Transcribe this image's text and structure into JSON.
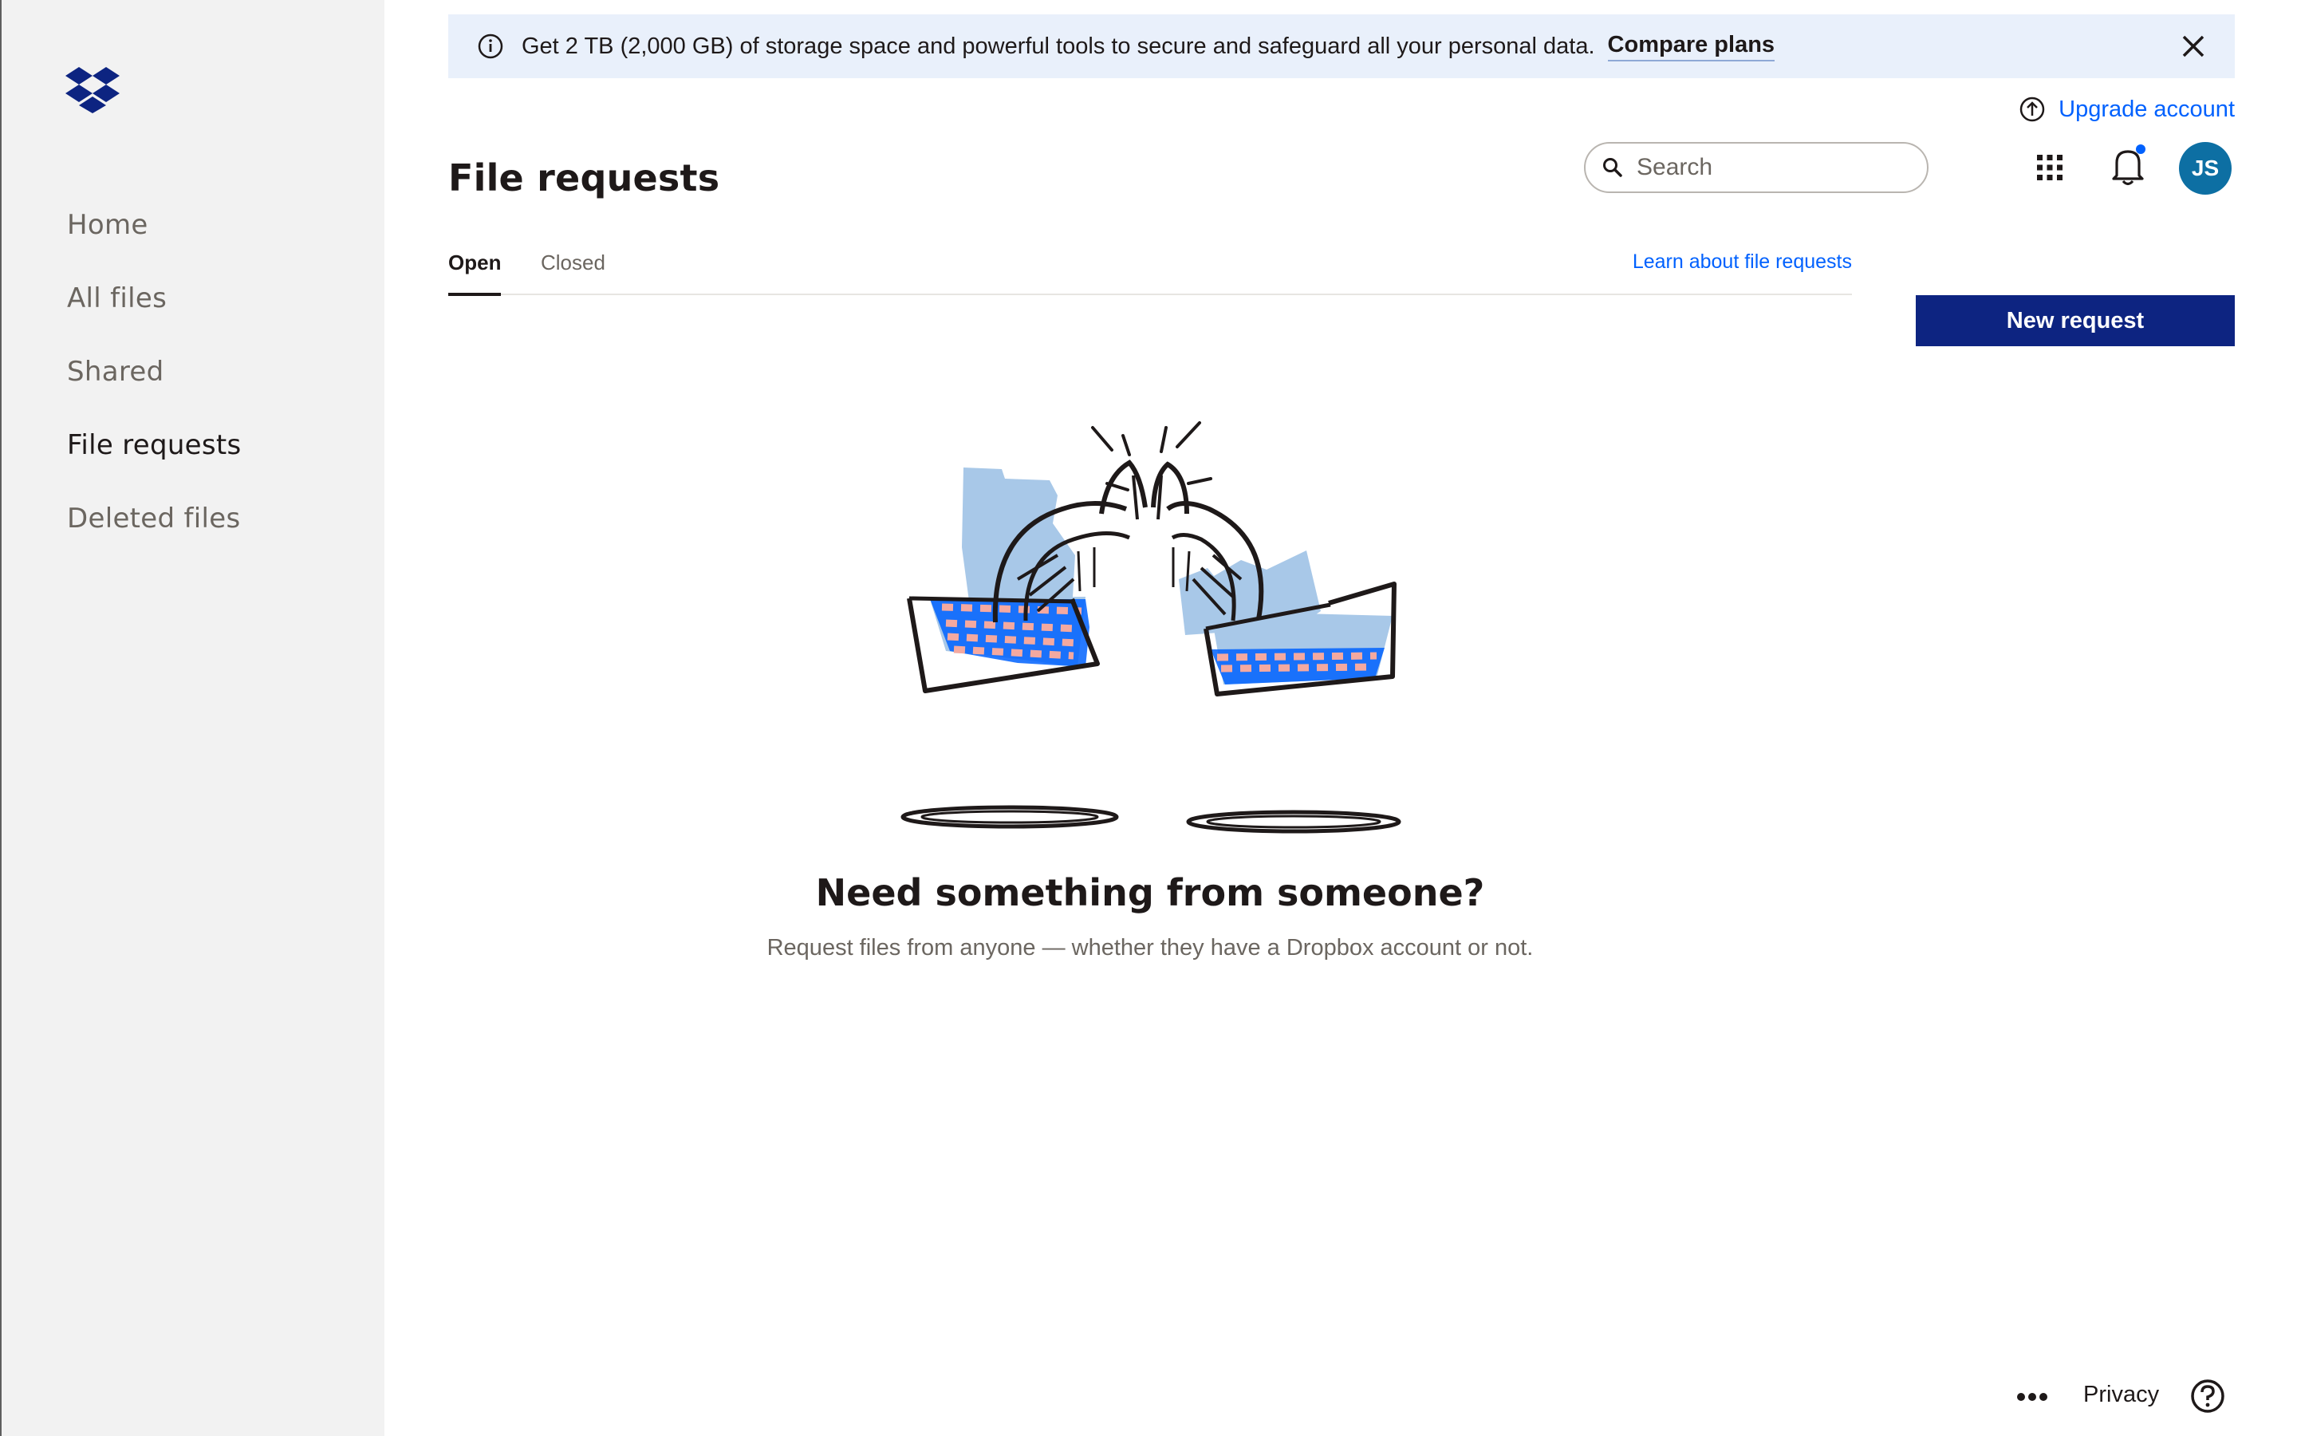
{
  "sidebar": {
    "logo_icon": "dropbox-logo",
    "items": [
      {
        "label": "Home",
        "active": false
      },
      {
        "label": "All files",
        "active": false
      },
      {
        "label": "Shared",
        "active": false
      },
      {
        "label": "File requests",
        "active": true
      },
      {
        "label": "Deleted files",
        "active": false
      }
    ]
  },
  "banner": {
    "icon": "info-icon",
    "message": "Get 2 TB (2,000 GB) of storage space and powerful tools to secure and safeguard all your personal data.",
    "link": "Compare plans",
    "close_icon": "close-icon"
  },
  "header": {
    "upgrade_label": "Upgrade account",
    "title": "File requests",
    "search_placeholder": "Search",
    "avatar_initials": "JS"
  },
  "tabs": [
    {
      "label": "Open",
      "active": true
    },
    {
      "label": "Closed",
      "active": false
    }
  ],
  "learn_link": "Learn about file requests",
  "new_request_label": "New request",
  "empty_state": {
    "title": "Need something from someone?",
    "subtitle": "Request files from anyone — whether they have a Dropbox account or not."
  },
  "footer": {
    "privacy_label": "Privacy"
  },
  "colors": {
    "primary_button": "#0d2481",
    "link": "#0061fe",
    "banner_bg": "#e9f0fb",
    "sidebar_bg": "#f2f2f2",
    "avatar_bg": "#0d6fa3"
  }
}
